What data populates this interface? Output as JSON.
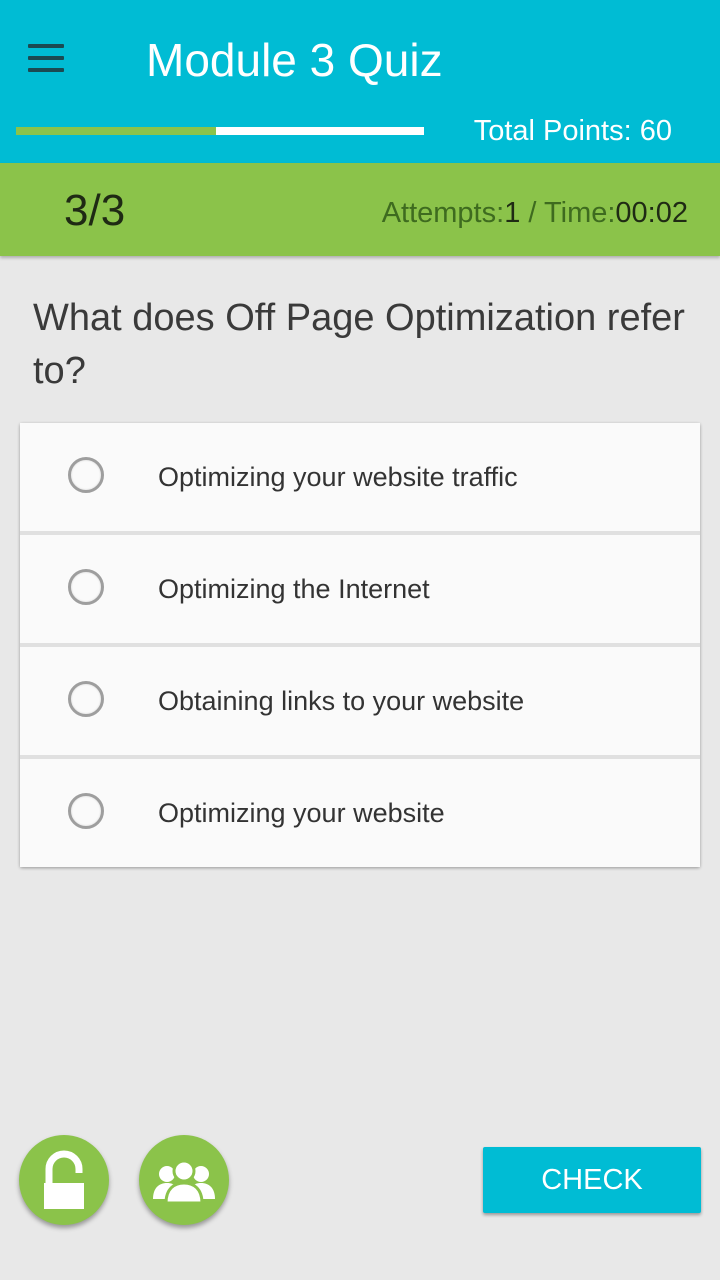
{
  "header": {
    "title": "Module 3 Quiz",
    "total_points": "Total Points: 60",
    "progress": 0.49
  },
  "status": {
    "counter": "3/3",
    "attempts_label": "Attempts:",
    "attempts_value": "1",
    "separator": " / ",
    "time_label": "Time:",
    "time_value": "00:02"
  },
  "question": "What does Off Page Optimization refer to?",
  "options": [
    {
      "label": "Optimizing your website traffic"
    },
    {
      "label": "Optimizing the Internet"
    },
    {
      "label": "Obtaining links to your website"
    },
    {
      "label": "Optimizing your website"
    }
  ],
  "actions": {
    "check_label": "CHECK",
    "lock_icon": "lock-icon",
    "people_icon": "people-icon"
  },
  "colors": {
    "primary": "#00bcd4",
    "accent": "#8bc34a"
  }
}
